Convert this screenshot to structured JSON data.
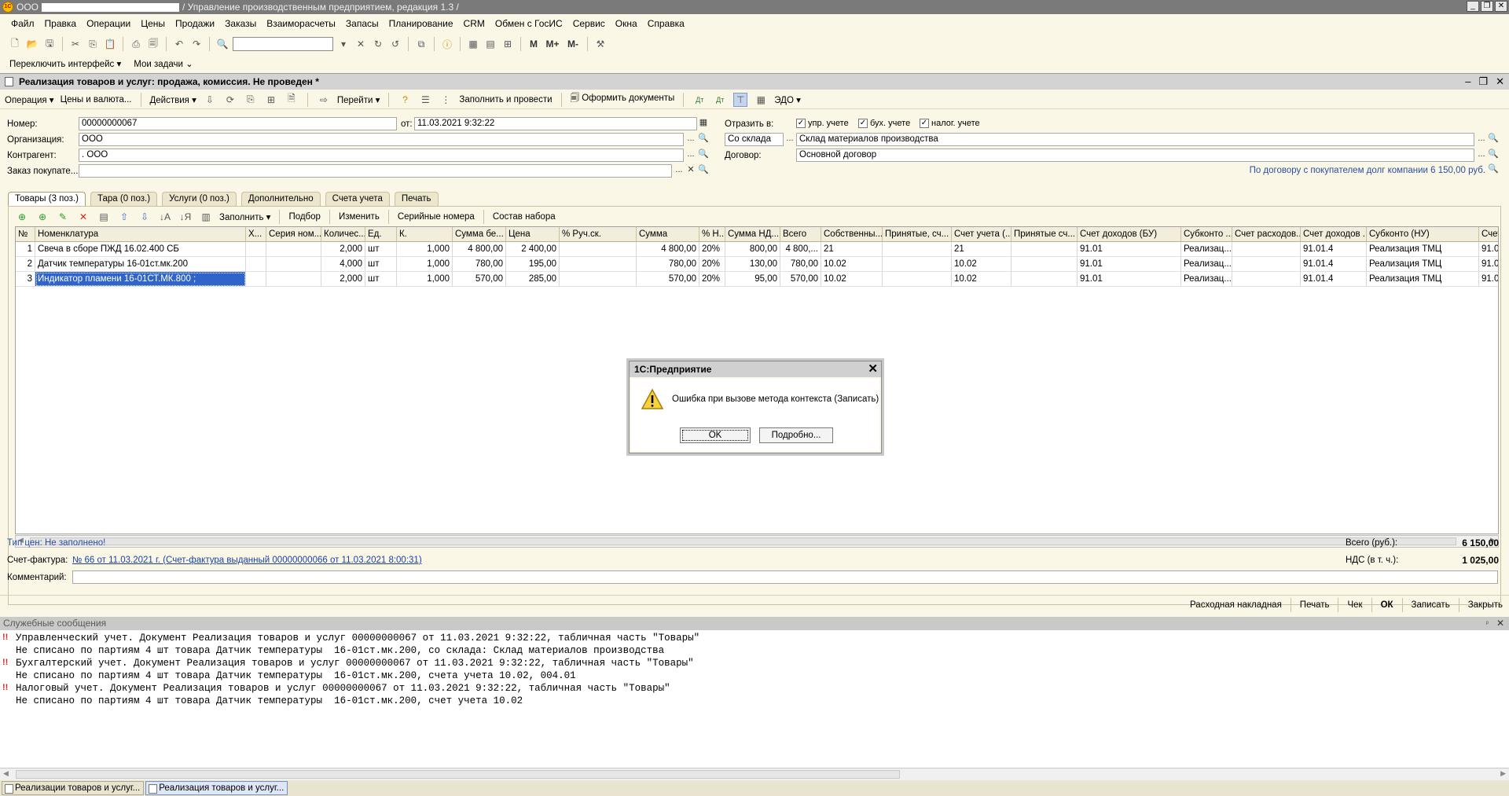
{
  "app": {
    "title_prefix": "ООО",
    "title_suffix": "/ Управление производственным предприятием, редакция 1.3 /"
  },
  "menu": [
    "Файл",
    "Правка",
    "Операции",
    "Цены",
    "Продажи",
    "Заказы",
    "Взаиморасчеты",
    "Запасы",
    "Планирование",
    "CRM",
    "Обмен с ГосИС",
    "Сервис",
    "Окна",
    "Справка"
  ],
  "toolbar": {
    "m_label": "M",
    "mplus_label": "M+",
    "mminus_label": "M-"
  },
  "panel": {
    "switch_interface": "Переключить интерфейс",
    "my_tasks": "Мои задачи"
  },
  "document": {
    "title": "Реализация товаров и услуг: продажа, комиссия. Не проведен *",
    "actions": {
      "operation": "Операция",
      "prices": "Цены и валюта...",
      "actions": "Действия",
      "go": "Перейти",
      "fill_post": "Заполнить и провести",
      "make_docs": "Оформить документы",
      "edo": "ЭДО"
    },
    "labels": {
      "number": "Номер:",
      "from": "от:",
      "org": "Организация:",
      "contractor": "Контрагент:",
      "order": "Заказ покупате...",
      "reflect": "Отразить в:",
      "contract": "Договор:",
      "warehouse_mode": "Со склада"
    },
    "values": {
      "number": "00000000067",
      "date": "11.03.2021  9:32:22",
      "org": "ООО",
      "contractor": ".                    ООО",
      "order": "",
      "warehouse": "Склад материалов производства",
      "contract": "Основной договор"
    },
    "checks": {
      "mgmt": "упр. учете",
      "acct": "бух. учете",
      "tax": "налог. учете"
    },
    "debt_note": "По договору с покупателем долг компании 6 150,00 руб."
  },
  "tabs": [
    "Товары (3 поз.)",
    "Тара (0 поз.)",
    "Услуги (0 поз.)",
    "Дополнительно",
    "Счета учета",
    "Печать"
  ],
  "grid_toolbar": {
    "fill": "Заполнить",
    "select": "Подбор",
    "change": "Изменить",
    "serials": "Серийные номера",
    "kit": "Состав набора"
  },
  "grid": {
    "columns": [
      "№",
      "Номенклатура",
      "Х...",
      "Серия ном...",
      "Количес...",
      "Ед.",
      "К.",
      "Сумма бе...",
      "Цена",
      "% Руч.ск.",
      "Сумма",
      "% Н...",
      "Сумма НД...",
      "Всего",
      "Собственны...",
      "Принятые, сч...",
      "Счет учета (...",
      "Принятые сч...",
      "Счет доходов (БУ)",
      "Субконто ...",
      "Счет расходов...",
      "Счет доходов ...",
      "Субконто (НУ)",
      "Счет"
    ],
    "rows": [
      [
        "1",
        "Свеча в сборе ПЖД 16.02.400 СБ",
        "",
        "",
        "2,000",
        "шт",
        "1,000",
        "4 800,00",
        "2 400,00",
        "",
        "4 800,00",
        "20%",
        "800,00",
        "4 800,...",
        "21",
        "",
        "21",
        "",
        "91.01",
        "Реализац...",
        "",
        "91.01.4",
        "Реализация ТМЦ",
        "91.0"
      ],
      [
        "2",
        "Датчик температуры  16-01ст.мк.200",
        "",
        "",
        "4,000",
        "шт",
        "1,000",
        "780,00",
        "195,00",
        "",
        "780,00",
        "20%",
        "130,00",
        "780,00",
        "10.02",
        "",
        "10.02",
        "",
        "91.01",
        "Реализац...",
        "",
        "91.01.4",
        "Реализация ТМЦ",
        "91.0"
      ],
      [
        "3",
        "Индикатор пламени 16-01СТ.МК.800 ;",
        "",
        "",
        "2,000",
        "шт",
        "1,000",
        "570,00",
        "285,00",
        "",
        "570,00",
        "20%",
        "95,00",
        "570,00",
        "10.02",
        "",
        "10.02",
        "",
        "91.01",
        "Реализац...",
        "",
        "91.01.4",
        "Реализация ТМЦ",
        "91.0"
      ]
    ]
  },
  "footer": {
    "price_type": "Тип цен: Не заполнено!",
    "invoice_label": "Счет-фактура:",
    "invoice_link": "№ 66 от 11.03.2021 г. (Счет-фактура выданный 00000000066 от 11.03.2021 8:00:31)",
    "comment_label": "Комментарий:",
    "total_label": "Всего (руб.):",
    "total_value": "6 150,00",
    "vat_label": "НДС (в т. ч.):",
    "vat_value": "1 025,00",
    "buttons": [
      "Расходная накладная",
      "Печать",
      "Чек",
      "ОК",
      "Записать",
      "Закрыть"
    ]
  },
  "modal": {
    "title": "1С:Предприятие",
    "message": "Ошибка при вызове метода контекста (Записать)",
    "ok": "OK",
    "details": "Подробно..."
  },
  "messages": {
    "title": "Служебные сообщения",
    "lines": [
      "Управленческий учет. Документ Реализация товаров и услуг 00000000067 от 11.03.2021 9:32:22, табличная часть \"Товары\"",
      "Не списано по партиям 4 шт товара Датчик температуры  16-01ст.мк.200, со склада: Склад материалов производства",
      "Бухгалтерский учет. Документ Реализация товаров и услуг 00000000067 от 11.03.2021 9:32:22, табличная часть \"Товары\"",
      "Не списано по партиям 4 шт товара Датчик температуры  16-01ст.мк.200, счета учета 10.02, 004.01",
      "Налоговый учет. Документ Реализация товаров и услуг 00000000067 от 11.03.2021 9:32:22, табличная часть \"Товары\"",
      "Не списано по партиям 4 шт товара Датчик температуры  16-01ст.мк.200, счет учета 10.02"
    ]
  },
  "taskbar": [
    "Реализации товаров и услуг...",
    "Реализация товаров и услуг..."
  ]
}
